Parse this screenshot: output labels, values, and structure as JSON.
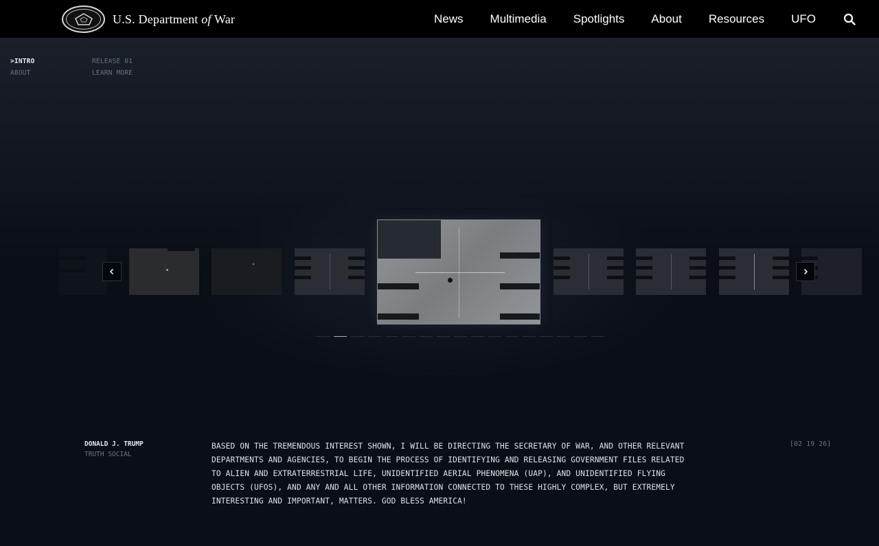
{
  "header": {
    "brand_prefix": "U.S. Department",
    "brand_of": "of",
    "brand_suffix": "War",
    "nav": [
      "News",
      "Multimedia",
      "Spotlights",
      "About",
      "Resources",
      "UFO"
    ],
    "search_icon": "search-icon"
  },
  "side_menu": {
    "col1": [
      ">INTRO",
      "ABOUT"
    ],
    "col2": [
      "RELEASE 01",
      "LEARN MORE"
    ]
  },
  "carousel": {
    "prev_icon": "chevron-left-icon",
    "next_icon": "chevron-right-icon",
    "page_count": 17,
    "active_page": 2
  },
  "quote": {
    "author": "DONALD J. TRUMP",
    "source": "TRUTH SOCIAL",
    "text": "BASED ON THE TREMENDOUS INTEREST SHOWN, I WILL BE DIRECTING THE SECRETARY OF WAR, AND OTHER RELEVANT DEPARTMENTS AND AGENCIES, TO BEGIN THE PROCESS OF IDENTIFYING AND RELEASING GOVERNMENT FILES RELATED TO ALIEN AND EXTRATERRESTRIAL LIFE, UNIDENTIFIED AERIAL PHENOMENA (UAP), AND UNIDENTIFIED FLYING OBJECTS (UFOS), AND ANY AND ALL OTHER INFORMATION CONNECTED TO THESE HIGHLY COMPLEX, BUT EXTREMELY INTERESTING AND IMPORTANT, MATTERS. GOD BLESS AMERICA!",
    "date": "[02 19 26]"
  },
  "colors": {
    "header_bg": "#000000",
    "page_bg": "#0a0e16",
    "text": "#e6e9ee",
    "dim_text": "#6d7480"
  }
}
